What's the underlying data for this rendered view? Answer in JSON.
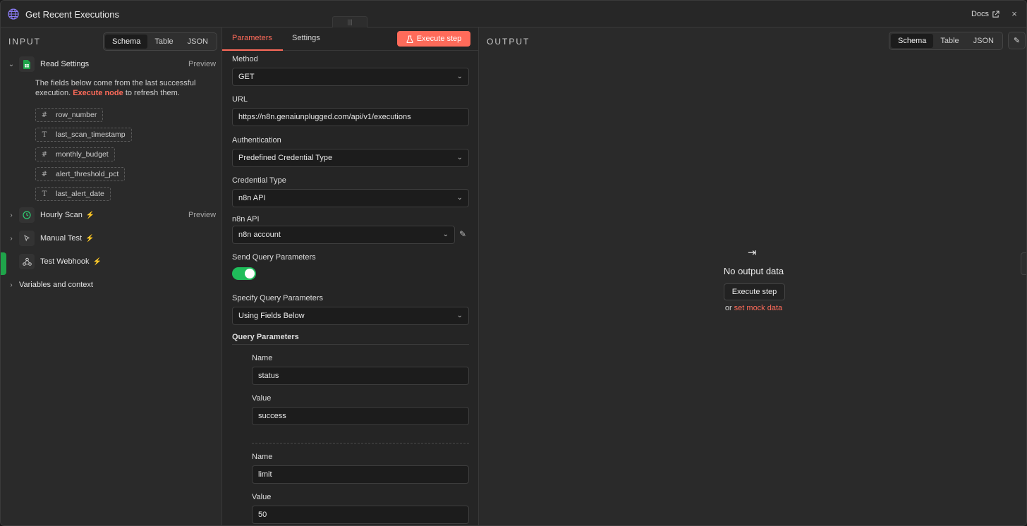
{
  "header": {
    "title": "Get Recent Executions",
    "docs_label": "Docs",
    "close_symbol": "×"
  },
  "input": {
    "label": "INPUT",
    "views": [
      "Schema",
      "Table",
      "JSON"
    ],
    "active_view": "Schema",
    "nodes": {
      "read_settings": {
        "label": "Read Settings",
        "preview": "Preview"
      },
      "hourly_scan": {
        "label": "Hourly Scan",
        "preview": "Preview"
      },
      "manual_test": {
        "label": "Manual Test"
      },
      "test_webhook": {
        "label": "Test Webhook"
      }
    },
    "description_pre": "The fields below come from the last successful execution.",
    "description_link": "Execute node",
    "description_post": "to refresh them.",
    "fields": [
      {
        "type": "#",
        "name": "row_number"
      },
      {
        "type": "T",
        "name": "last_scan_timestamp"
      },
      {
        "type": "#",
        "name": "monthly_budget"
      },
      {
        "type": "#",
        "name": "alert_threshold_pct"
      },
      {
        "type": "T",
        "name": "last_alert_date"
      }
    ],
    "variables_label": "Variables and context"
  },
  "params": {
    "tabs": [
      "Parameters",
      "Settings"
    ],
    "active_tab": "Parameters",
    "execute_label": "Execute step",
    "method_label": "Method",
    "method_value": "GET",
    "url_label": "URL",
    "url_value": "https://n8n.genaiunplugged.com/api/v1/executions",
    "auth_label": "Authentication",
    "auth_value": "Predefined Credential Type",
    "cred_type_label": "Credential Type",
    "cred_type_value": "n8n API",
    "api_label": "n8n API",
    "api_value": "n8n account",
    "send_query_label": "Send Query Parameters",
    "send_query_enabled": true,
    "specify_label": "Specify Query Parameters",
    "specify_value": "Using Fields Below",
    "query_params_title": "Query Parameters",
    "query_params": [
      {
        "name_label": "Name",
        "name": "status",
        "value_label": "Value",
        "value": "success"
      },
      {
        "name_label": "Name",
        "name": "limit",
        "value_label": "Value",
        "value": "50"
      }
    ]
  },
  "output": {
    "label": "OUTPUT",
    "views": [
      "Schema",
      "Table",
      "JSON"
    ],
    "active_view": "Schema",
    "empty_title": "No output data",
    "empty_button": "Execute step",
    "or_text": "or",
    "mock_link": "set mock data"
  },
  "colors": {
    "accent": "#ff6b5a",
    "toggle_on": "#1fbd5a",
    "sheets_green": "#1fa44a",
    "clock_green": "#2ecc71"
  }
}
